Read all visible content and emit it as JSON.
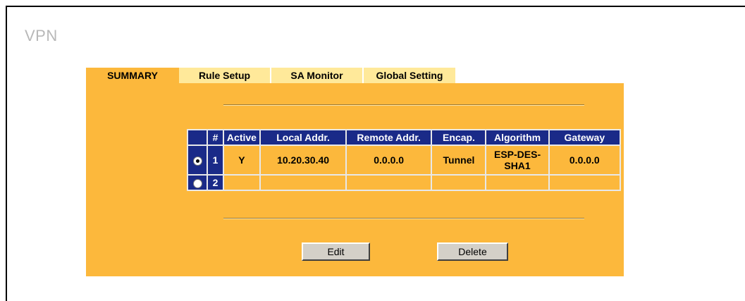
{
  "page": {
    "title": "VPN"
  },
  "tabs": [
    {
      "label": "SUMMARY",
      "active": true
    },
    {
      "label": "Rule Setup",
      "active": false
    },
    {
      "label": "SA Monitor",
      "active": false
    },
    {
      "label": "Global Setting",
      "active": false
    }
  ],
  "table": {
    "headers": [
      "#",
      "Active",
      "Local Addr.",
      "Remote Addr.",
      "Encap.",
      "Algorithm",
      "Gateway"
    ],
    "rows": [
      {
        "selected": true,
        "num": "1",
        "active": "Y",
        "local": "10.20.30.40",
        "remote": "0.0.0.0",
        "encap": "Tunnel",
        "algorithm": "ESP-DES-SHA1",
        "gateway": "0.0.0.0"
      },
      {
        "selected": false,
        "num": "2",
        "active": "",
        "local": "",
        "remote": "",
        "encap": "",
        "algorithm": "",
        "gateway": ""
      }
    ]
  },
  "buttons": {
    "edit": "Edit",
    "delete": "Delete"
  },
  "colors": {
    "panel": "#fcb83c",
    "tab_inactive": "#ffe99a",
    "header": "#1a2a88"
  }
}
